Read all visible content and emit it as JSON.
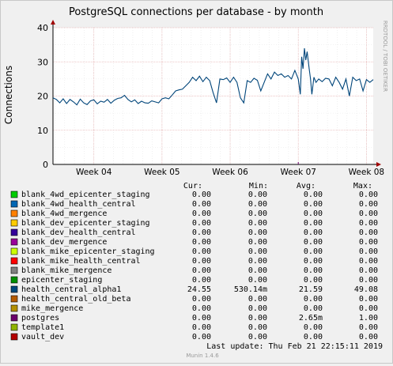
{
  "chart_data": {
    "type": "line",
    "title": "PostgreSQL connections per database - by month",
    "ylabel": "Connections",
    "side_label": "RRDTOOL / TOBI OETIKER",
    "ylim": [
      0,
      40
    ],
    "yticks": [
      0,
      10,
      20,
      30,
      40
    ],
    "xlim": [
      3.4,
      8.1
    ],
    "xticks": [
      {
        "label": "Week 04",
        "x": 4
      },
      {
        "label": "Week 05",
        "x": 5
      },
      {
        "label": "Week 06",
        "x": 6
      },
      {
        "label": "Week 07",
        "x": 7
      },
      {
        "label": "Week 08",
        "x": 8
      }
    ],
    "grid": true,
    "series": [
      {
        "name": "health_central_alpha1",
        "color": "#00457a",
        "points": [
          [
            3.4,
            19.5
          ],
          [
            3.45,
            19.0
          ],
          [
            3.5,
            18.0
          ],
          [
            3.55,
            19.2
          ],
          [
            3.6,
            17.8
          ],
          [
            3.65,
            19.0
          ],
          [
            3.7,
            18.3
          ],
          [
            3.75,
            17.4
          ],
          [
            3.8,
            19.1
          ],
          [
            3.85,
            18.0
          ],
          [
            3.9,
            17.5
          ],
          [
            3.95,
            18.6
          ],
          [
            4.0,
            18.9
          ],
          [
            4.05,
            17.7
          ],
          [
            4.1,
            18.5
          ],
          [
            4.15,
            18.2
          ],
          [
            4.2,
            19.0
          ],
          [
            4.25,
            17.9
          ],
          [
            4.3,
            18.8
          ],
          [
            4.35,
            19.3
          ],
          [
            4.4,
            19.5
          ],
          [
            4.45,
            20.2
          ],
          [
            4.5,
            19.0
          ],
          [
            4.55,
            18.3
          ],
          [
            4.6,
            18.9
          ],
          [
            4.65,
            17.8
          ],
          [
            4.7,
            18.5
          ],
          [
            4.75,
            18.0
          ],
          [
            4.8,
            17.9
          ],
          [
            4.85,
            18.6
          ],
          [
            4.9,
            18.3
          ],
          [
            4.95,
            18.0
          ],
          [
            5.0,
            19.2
          ],
          [
            5.05,
            19.5
          ],
          [
            5.1,
            19.2
          ],
          [
            5.15,
            20.3
          ],
          [
            5.2,
            21.5
          ],
          [
            5.25,
            21.8
          ],
          [
            5.3,
            22.0
          ],
          [
            5.35,
            23.0
          ],
          [
            5.4,
            24.0
          ],
          [
            5.45,
            25.5
          ],
          [
            5.5,
            24.5
          ],
          [
            5.55,
            25.8
          ],
          [
            5.6,
            24.2
          ],
          [
            5.65,
            25.5
          ],
          [
            5.7,
            24.5
          ],
          [
            5.75,
            21.0
          ],
          [
            5.8,
            18.0
          ],
          [
            5.85,
            25.0
          ],
          [
            5.9,
            24.8
          ],
          [
            5.95,
            25.3
          ],
          [
            6.0,
            24.0
          ],
          [
            6.05,
            25.5
          ],
          [
            6.1,
            24.0
          ],
          [
            6.15,
            19.5
          ],
          [
            6.2,
            18.0
          ],
          [
            6.25,
            24.5
          ],
          [
            6.3,
            24.0
          ],
          [
            6.35,
            25.2
          ],
          [
            6.4,
            24.6
          ],
          [
            6.45,
            21.5
          ],
          [
            6.5,
            24.0
          ],
          [
            6.55,
            26.5
          ],
          [
            6.6,
            25.0
          ],
          [
            6.65,
            27.0
          ],
          [
            6.7,
            26.0
          ],
          [
            6.75,
            26.5
          ],
          [
            6.8,
            25.5
          ],
          [
            6.85,
            26.0
          ],
          [
            6.9,
            25.0
          ],
          [
            6.95,
            27.5
          ],
          [
            7.0,
            25.0
          ],
          [
            7.03,
            20.5
          ],
          [
            7.05,
            31.5
          ],
          [
            7.07,
            28.0
          ],
          [
            7.09,
            34.0
          ],
          [
            7.11,
            30.5
          ],
          [
            7.13,
            33.0
          ],
          [
            7.16,
            28.0
          ],
          [
            7.18,
            25.0
          ],
          [
            7.2,
            20.5
          ],
          [
            7.23,
            25.5
          ],
          [
            7.26,
            24.0
          ],
          [
            7.3,
            25.0
          ],
          [
            7.35,
            24.2
          ],
          [
            7.4,
            25.2
          ],
          [
            7.45,
            25.0
          ],
          [
            7.5,
            23.0
          ],
          [
            7.55,
            25.5
          ],
          [
            7.6,
            24.0
          ],
          [
            7.65,
            22.0
          ],
          [
            7.7,
            25.0
          ],
          [
            7.75,
            20.0
          ],
          [
            7.8,
            25.5
          ],
          [
            7.85,
            24.5
          ],
          [
            7.9,
            25.0
          ],
          [
            7.95,
            21.5
          ],
          [
            8.0,
            24.8
          ],
          [
            8.05,
            24.0
          ],
          [
            8.1,
            24.8
          ]
        ]
      }
    ]
  },
  "legend": {
    "headers": {
      "cur": "Cur:",
      "min": "Min:",
      "avg": "Avg:",
      "max": "Max:"
    },
    "rows": [
      {
        "name": "blank_4wd_epicenter_staging",
        "color": "#00cc00",
        "cur": "0.00",
        "min": "0.00",
        "avg": "0.00",
        "max": "0.00"
      },
      {
        "name": "blank_4wd_health_central",
        "color": "#0066b3",
        "cur": "0.00",
        "min": "0.00",
        "avg": "0.00",
        "max": "0.00"
      },
      {
        "name": "blank_4wd_mergence",
        "color": "#ff8000",
        "cur": "0.00",
        "min": "0.00",
        "avg": "0.00",
        "max": "0.00"
      },
      {
        "name": "blank_dev_epicenter_staging",
        "color": "#ffcc00",
        "cur": "0.00",
        "min": "0.00",
        "avg": "0.00",
        "max": "0.00"
      },
      {
        "name": "blank_dev_health_central",
        "color": "#330099",
        "cur": "0.00",
        "min": "0.00",
        "avg": "0.00",
        "max": "0.00"
      },
      {
        "name": "blank_dev_mergence",
        "color": "#990099",
        "cur": "0.00",
        "min": "0.00",
        "avg": "0.00",
        "max": "0.00"
      },
      {
        "name": "blank_mike_epicenter_staging",
        "color": "#ccff00",
        "cur": "0.00",
        "min": "0.00",
        "avg": "0.00",
        "max": "0.00"
      },
      {
        "name": "blank_mike_health_central",
        "color": "#ff0000",
        "cur": "0.00",
        "min": "0.00",
        "avg": "0.00",
        "max": "0.00"
      },
      {
        "name": "blank_mike_mergence",
        "color": "#808080",
        "cur": "0.00",
        "min": "0.00",
        "avg": "0.00",
        "max": "0.00"
      },
      {
        "name": "epicenter_staging",
        "color": "#008f00",
        "cur": "0.00",
        "min": "0.00",
        "avg": "0.00",
        "max": "0.00"
      },
      {
        "name": "health_central_alpha1",
        "color": "#00487d",
        "cur": "24.55",
        "min": "530.14m",
        "avg": "21.59",
        "max": "49.08"
      },
      {
        "name": "health_central_old_beta",
        "color": "#b35a00",
        "cur": "0.00",
        "min": "0.00",
        "avg": "0.00",
        "max": "0.00"
      },
      {
        "name": "mike_mergence",
        "color": "#b38f00",
        "cur": "0.00",
        "min": "0.00",
        "avg": "0.00",
        "max": "0.00"
      },
      {
        "name": "postgres",
        "color": "#6b006b",
        "cur": "0.00",
        "min": "0.00",
        "avg": "2.65m",
        "max": "1.00"
      },
      {
        "name": "template1",
        "color": "#8fb300",
        "cur": "0.00",
        "min": "0.00",
        "avg": "0.00",
        "max": "0.00"
      },
      {
        "name": "vault_dev",
        "color": "#b30000",
        "cur": "0.00",
        "min": "0.00",
        "avg": "0.00",
        "max": "0.00"
      }
    ]
  },
  "footer": {
    "last_update": "Last update:  Thu Feb 21 22:15:11 2019",
    "munin": "Munin 1.4.6"
  },
  "colors": {
    "background": "#f0f0f0",
    "plot_bg": "#ffffff",
    "grid_major": "#e6b3b3",
    "axis": "#000000",
    "arrow": "#a00000"
  }
}
